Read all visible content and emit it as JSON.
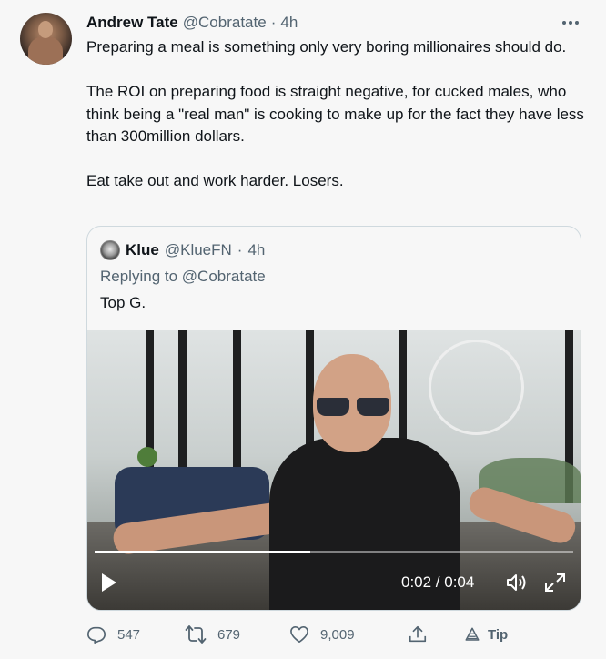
{
  "tweet": {
    "author_name": "Andrew Tate",
    "author_handle": "@Cobratate",
    "separator": "·",
    "time": "4h",
    "paragraphs": [
      "Preparing a meal is something only very boring millionaires should do.",
      "The ROI on preparing food is straight negative, for cucked males, who think being a \"real man\" is cooking to make up for the fact they have less than 300million dollars.",
      "Eat take out and work harder. Losers."
    ]
  },
  "quote": {
    "author_name": "Klue",
    "author_handle": "@KlueFN",
    "separator": "·",
    "time": "4h",
    "replying_prefix": "Replying to",
    "replying_to": "@Cobratate",
    "text": "Top G."
  },
  "video": {
    "time_readout": "0:02 / 0:04",
    "progress_fraction": 0.45
  },
  "actions": {
    "replies": "547",
    "retweets": "679",
    "likes": "9,009",
    "tip_label": "Tip"
  },
  "icons": {
    "more": "more-icon",
    "reply": "reply-icon",
    "retweet": "retweet-icon",
    "like": "heart-icon",
    "share": "share-icon",
    "tip": "tip-icon",
    "play": "play-icon",
    "volume": "volume-icon",
    "fullscreen": "fullscreen-icon"
  },
  "colors": {
    "text_primary": "#0f1419",
    "text_secondary": "#536471",
    "border": "#cfd9de",
    "background": "#f7f7f7"
  }
}
